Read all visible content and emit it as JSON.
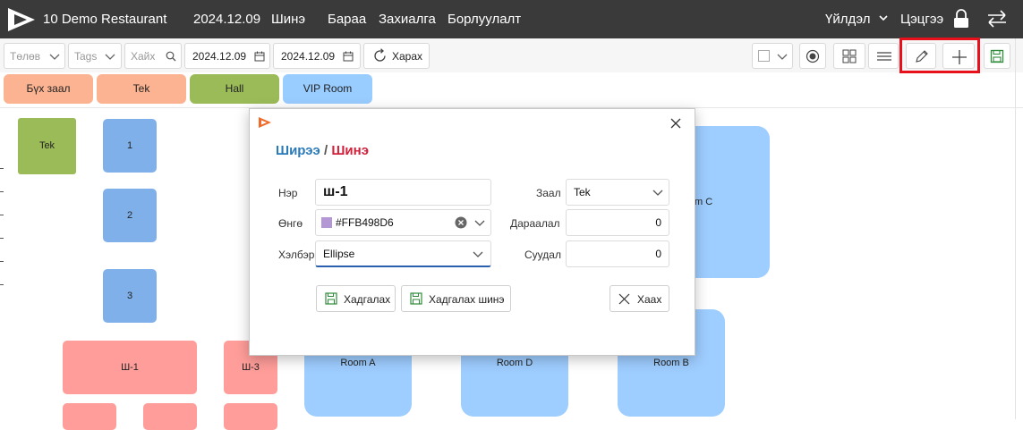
{
  "app": {
    "brand": "10 Demo Restaurant",
    "date": "2024.12.09",
    "nav": [
      "Шинэ",
      "Бараа",
      "Захиалга",
      "Борлуулалт"
    ],
    "operation": "Үйлдэл",
    "user": "Цэцгээ"
  },
  "toolbar": {
    "status_placeholder": "Төлөв",
    "tags_placeholder": "Tags",
    "search_placeholder": "Хайх",
    "date_from": "2024.12.09",
    "date_to": "2024.12.09",
    "view_label": "Харах"
  },
  "tabs": [
    {
      "label": "Бүх заал",
      "color": "#fbb391"
    },
    {
      "label": "Tek",
      "color": "#fbb391"
    },
    {
      "label": "Hall",
      "color": "#9bbb59"
    },
    {
      "label": "VIP Room",
      "color": "#99ccff"
    }
  ],
  "tables": {
    "tek": "Tek",
    "t1": "1",
    "t2": "2",
    "t3": "3",
    "sh1": "Ш-1",
    "sh3": "Ш-3",
    "room_a": "Room A",
    "room_b": "Room B",
    "room_c": "m C",
    "room_d": "Room D"
  },
  "dialog": {
    "title_part1": "Ширээ",
    "separator": " / ",
    "title_part2": "Шинэ",
    "name_label": "Нэр",
    "name_value": "ш-1",
    "color_label": "Өнгө",
    "color_value": "#FFB498D6",
    "color_swatch": "#b498d6",
    "shape_label": "Хэлбэр",
    "shape_value": "Ellipse",
    "hall_label": "Заал",
    "hall_value": "Tek",
    "order_label": "Дараалал",
    "order_value": "0",
    "row_label": "Суудал",
    "row_value": "0",
    "save_label": "Хадгалах",
    "save_new_label": "Хадгалах шинэ",
    "close_label": "Хаах"
  },
  "colors": {
    "blue_table": "#80b0ea",
    "red_table": "#ff9d9a",
    "room": "#9ecdff",
    "green": "#9bbb59",
    "title_blue": "#2a7ab8",
    "title_red": "#d0203a",
    "highlight": "#e8101b"
  }
}
